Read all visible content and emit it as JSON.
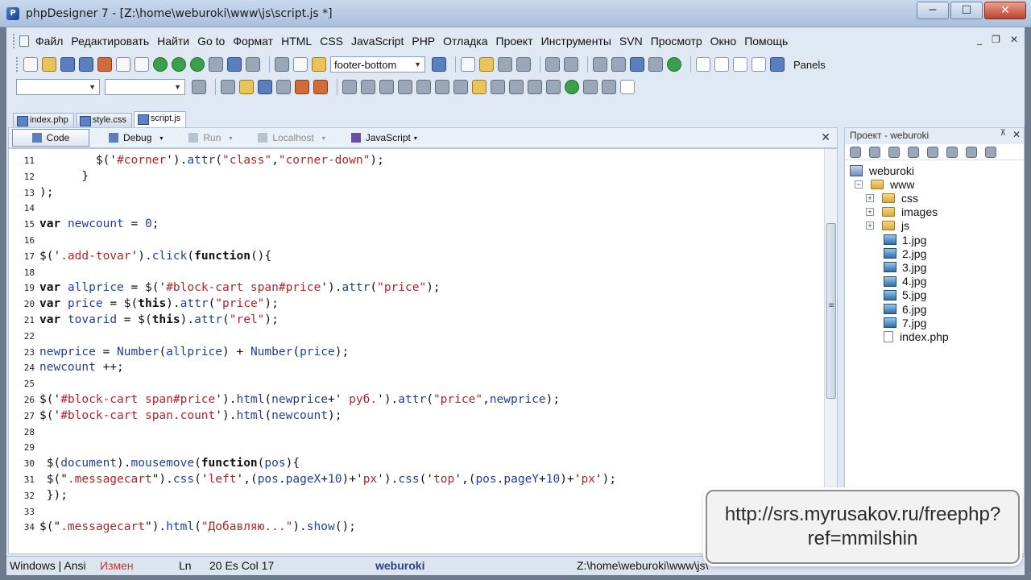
{
  "window": {
    "title": "phpDesigner 7 - [Z:\\home\\weburoki\\www\\js\\script.js *]",
    "app_icon_glyph": "P",
    "minimize_glyph": "─",
    "maximize_glyph": "☐",
    "close_glyph": "✕"
  },
  "menu": {
    "items": [
      "Файл",
      "Редактировать",
      "Найти",
      "Go to",
      "Формат",
      "HTML",
      "CSS",
      "JavaScript",
      "PHP",
      "Отладка",
      "Проект",
      "Инструменты",
      "SVN",
      "Просмотр",
      "Окно",
      "Помощь"
    ],
    "mdi_minimize": "_",
    "mdi_restore": "❐",
    "mdi_close": "✕"
  },
  "toolbar": {
    "template_combo": "footer-bottom",
    "panels_label": "Panels",
    "combo_arrow": "▼"
  },
  "tabs": [
    {
      "label": "index.php",
      "active": false
    },
    {
      "label": "style.css",
      "active": false
    },
    {
      "label": "script.js",
      "active": true
    }
  ],
  "editor_bar": {
    "code": "Code",
    "debug": "Debug",
    "run": "Run",
    "localhost": "Localhost",
    "language": "JavaScript",
    "caret": "▾",
    "close": "✕"
  },
  "code_lines": [
    {
      "n": "11",
      "tokens": [
        [
          "p",
          "        $('"
        ],
        [
          "str",
          "#corner"
        ],
        [
          "p",
          "')."
        ],
        [
          "id",
          "attr"
        ],
        [
          "p",
          "("
        ],
        [
          "str",
          "\"class\""
        ],
        [
          "p",
          ","
        ],
        [
          "str",
          "\"corner-down\""
        ],
        [
          "p",
          ");"
        ]
      ]
    },
    {
      "n": "12",
      "tokens": [
        [
          "p",
          "      }"
        ]
      ]
    },
    {
      "n": "13",
      "tokens": [
        [
          "p",
          ");"
        ]
      ]
    },
    {
      "n": "14",
      "tokens": []
    },
    {
      "n": "15",
      "tokens": [
        [
          "kw",
          "var"
        ],
        [
          "p",
          " "
        ],
        [
          "id",
          "newcount"
        ],
        [
          "p",
          " = "
        ],
        [
          "id",
          "0"
        ],
        [
          "p",
          ";"
        ]
      ]
    },
    {
      "n": "16",
      "tokens": []
    },
    {
      "n": "17",
      "tokens": [
        [
          "p",
          "$('"
        ],
        [
          "str",
          ".add-tovar"
        ],
        [
          "p",
          "')."
        ],
        [
          "id",
          "click"
        ],
        [
          "p",
          "("
        ],
        [
          "kw",
          "function"
        ],
        [
          "p",
          "(){"
        ]
      ]
    },
    {
      "n": "18",
      "tokens": []
    },
    {
      "n": "19",
      "tokens": [
        [
          "kw",
          "var"
        ],
        [
          "p",
          " "
        ],
        [
          "id",
          "allprice"
        ],
        [
          "p",
          " = $('"
        ],
        [
          "str",
          "#block-cart span#price"
        ],
        [
          "p",
          "')."
        ],
        [
          "id",
          "attr"
        ],
        [
          "p",
          "("
        ],
        [
          "str",
          "\"price\""
        ],
        [
          "p",
          ");"
        ]
      ]
    },
    {
      "n": "20",
      "tokens": [
        [
          "kw",
          "var"
        ],
        [
          "p",
          " "
        ],
        [
          "id",
          "price"
        ],
        [
          "p",
          " = $("
        ],
        [
          "kw",
          "this"
        ],
        [
          "p",
          ")."
        ],
        [
          "id",
          "attr"
        ],
        [
          "p",
          "("
        ],
        [
          "str",
          "\"price\""
        ],
        [
          "p",
          ");"
        ]
      ]
    },
    {
      "n": "21",
      "tokens": [
        [
          "kw",
          "var"
        ],
        [
          "p",
          " "
        ],
        [
          "id",
          "tovarid"
        ],
        [
          "p",
          " = $("
        ],
        [
          "kw",
          "this"
        ],
        [
          "p",
          ")."
        ],
        [
          "id",
          "attr"
        ],
        [
          "p",
          "("
        ],
        [
          "str",
          "\"rel\""
        ],
        [
          "p",
          ");"
        ]
      ]
    },
    {
      "n": "22",
      "tokens": []
    },
    {
      "n": "23",
      "tokens": [
        [
          "id",
          "newprice"
        ],
        [
          "p",
          " = "
        ],
        [
          "id",
          "Number"
        ],
        [
          "p",
          "("
        ],
        [
          "id",
          "allprice"
        ],
        [
          "p",
          ") + "
        ],
        [
          "id",
          "Number"
        ],
        [
          "p",
          "("
        ],
        [
          "id",
          "price"
        ],
        [
          "p",
          ");"
        ]
      ]
    },
    {
      "n": "24",
      "tokens": [
        [
          "id",
          "newcount"
        ],
        [
          "p",
          " ++;"
        ]
      ]
    },
    {
      "n": "25",
      "tokens": []
    },
    {
      "n": "26",
      "tokens": [
        [
          "p",
          "$('"
        ],
        [
          "str",
          "#block-cart span#price"
        ],
        [
          "p",
          "')."
        ],
        [
          "id",
          "html"
        ],
        [
          "p",
          "("
        ],
        [
          "id",
          "newprice"
        ],
        [
          "p",
          "+'"
        ],
        [
          "str",
          " руб."
        ],
        [
          "p",
          "')."
        ],
        [
          "id",
          "attr"
        ],
        [
          "p",
          "("
        ],
        [
          "str",
          "\"price\""
        ],
        [
          "p",
          ","
        ],
        [
          "id",
          "newprice"
        ],
        [
          "p",
          ");"
        ]
      ]
    },
    {
      "n": "27",
      "tokens": [
        [
          "p",
          "$('"
        ],
        [
          "str",
          "#block-cart span.count"
        ],
        [
          "p",
          "')."
        ],
        [
          "id",
          "html"
        ],
        [
          "p",
          "("
        ],
        [
          "id",
          "newcount"
        ],
        [
          "p",
          ");"
        ]
      ]
    },
    {
      "n": "28",
      "tokens": []
    },
    {
      "n": "29",
      "tokens": []
    },
    {
      "n": "30",
      "tokens": [
        [
          "p",
          " $("
        ],
        [
          "id",
          "document"
        ],
        [
          "p",
          ")."
        ],
        [
          "id",
          "mousemove"
        ],
        [
          "p",
          "("
        ],
        [
          "kw",
          "function"
        ],
        [
          "p",
          "("
        ],
        [
          "id",
          "pos"
        ],
        [
          "p",
          "){"
        ]
      ]
    },
    {
      "n": "31",
      "tokens": [
        [
          "p",
          " $(\""
        ],
        [
          "str",
          ".messagecart"
        ],
        [
          "p",
          "\")."
        ],
        [
          "id",
          "css"
        ],
        [
          "p",
          "('"
        ],
        [
          "str",
          "left"
        ],
        [
          "p",
          "',("
        ],
        [
          "id",
          "pos"
        ],
        [
          "p",
          "."
        ],
        [
          "id",
          "pageX"
        ],
        [
          "p",
          "+"
        ],
        [
          "id",
          "10"
        ],
        [
          "p",
          ")+'"
        ],
        [
          "str",
          "px"
        ],
        [
          "p",
          "')."
        ],
        [
          "id",
          "css"
        ],
        [
          "p",
          "('"
        ],
        [
          "str",
          "top"
        ],
        [
          "p",
          "',("
        ],
        [
          "id",
          "pos"
        ],
        [
          "p",
          "."
        ],
        [
          "id",
          "pageY"
        ],
        [
          "p",
          "+"
        ],
        [
          "id",
          "10"
        ],
        [
          "p",
          ")+'"
        ],
        [
          "str",
          "px"
        ],
        [
          "p",
          "');"
        ]
      ]
    },
    {
      "n": "32",
      "tokens": [
        [
          "p",
          " });"
        ]
      ]
    },
    {
      "n": "33",
      "tokens": []
    },
    {
      "n": "34",
      "tokens": [
        [
          "p",
          "$(\""
        ],
        [
          "str",
          ".messagecart"
        ],
        [
          "p",
          "\")."
        ],
        [
          "id",
          "html"
        ],
        [
          "p",
          "("
        ],
        [
          "str",
          "\"Добавляю...\""
        ],
        [
          "p",
          ")."
        ],
        [
          "id",
          "show"
        ],
        [
          "p",
          "();"
        ]
      ]
    }
  ],
  "project_panel": {
    "title": "Проект - weburoki",
    "pin": "⊼",
    "close": "✕",
    "tree": [
      {
        "label": "weburoki",
        "depth": 0,
        "icon": "root",
        "toggle": ""
      },
      {
        "label": "www",
        "depth": 1,
        "icon": "folder",
        "toggle": "−"
      },
      {
        "label": "css",
        "depth": 2,
        "icon": "folder",
        "toggle": "+"
      },
      {
        "label": "images",
        "depth": 2,
        "icon": "folder",
        "toggle": "+"
      },
      {
        "label": "js",
        "depth": 2,
        "icon": "folder",
        "toggle": "+"
      },
      {
        "label": "1.jpg",
        "depth": 3,
        "icon": "image",
        "toggle": ""
      },
      {
        "label": "2.jpg",
        "depth": 3,
        "icon": "image",
        "toggle": ""
      },
      {
        "label": "3.jpg",
        "depth": 3,
        "icon": "image",
        "toggle": ""
      },
      {
        "label": "4.jpg",
        "depth": 3,
        "icon": "image",
        "toggle": ""
      },
      {
        "label": "5.jpg",
        "depth": 3,
        "icon": "image",
        "toggle": ""
      },
      {
        "label": "6.jpg",
        "depth": 3,
        "icon": "image",
        "toggle": ""
      },
      {
        "label": "7.jpg",
        "depth": 3,
        "icon": "image",
        "toggle": ""
      },
      {
        "label": "index.php",
        "depth": 3,
        "icon": "file",
        "toggle": ""
      }
    ]
  },
  "status": {
    "encoding": "Windows | Ansi",
    "modified": "Измен",
    "ln_label": "Ln",
    "ln_col": "20 Es Col 17",
    "project": "weburoki",
    "path": "Z:\\home\\weburoki\\www\\js\\"
  },
  "overlay": {
    "line1": "http://srs.myrusakov.ru/freephp?",
    "line2": "ref=mmilshin"
  },
  "colors": {
    "keyword": "#111111",
    "identifier": "#233f94",
    "string": "#b0262a",
    "accent": "#2a3f8a"
  }
}
